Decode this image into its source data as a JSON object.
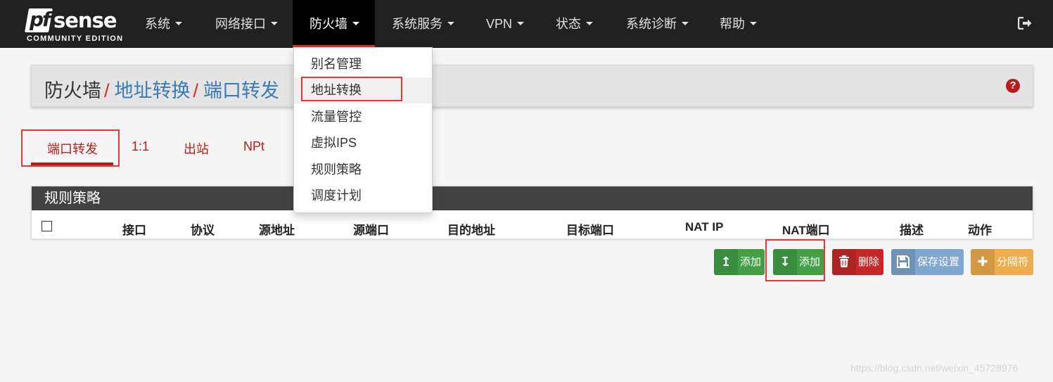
{
  "brand": {
    "logo_pf": "pf",
    "logo_sense": "sense",
    "edition": "COMMUNITY EDITION"
  },
  "nav": {
    "items": [
      {
        "label": "系统"
      },
      {
        "label": "网络接口"
      },
      {
        "label": "防火墙"
      },
      {
        "label": "系统服务"
      },
      {
        "label": "VPN"
      },
      {
        "label": "状态"
      },
      {
        "label": "系统诊断"
      },
      {
        "label": "帮助"
      }
    ],
    "active": "防火墙",
    "logout_icon": "sign-out-icon"
  },
  "breadcrumb": {
    "items": [
      "防火墙",
      "地址转换",
      "端口转发"
    ],
    "separator": "/",
    "help_icon": "question-circle-icon",
    "help_glyph": "?"
  },
  "dropdown": {
    "items": [
      "别名管理",
      "地址转换",
      "流量管控",
      "虚拟IPS",
      "规则策略",
      "调度计划"
    ],
    "highlighted": "地址转换"
  },
  "tabs": {
    "items": [
      "端口转发",
      "1:1",
      "出站",
      "NPt"
    ],
    "active": "端口转发"
  },
  "table": {
    "heading": "规则策略",
    "columns": [
      "接口",
      "协议",
      "源地址",
      "源端口",
      "目的地址",
      "目标端口",
      "NAT IP",
      "NAT端口",
      "描述",
      "动作"
    ]
  },
  "buttons": [
    {
      "label": "添加",
      "icon": "arrow-up-icon",
      "glyph": "↥",
      "color": "#43a047"
    },
    {
      "label": "添加",
      "icon": "arrow-down-icon",
      "glyph": "↧",
      "color": "#43a047"
    },
    {
      "label": "删除",
      "icon": "trash-icon",
      "glyph": "🗑",
      "color": "#c62828"
    },
    {
      "label": "保存设置",
      "icon": "save-icon",
      "glyph": "💾",
      "color": "#7fa7cf"
    },
    {
      "label": "分隔符",
      "icon": "plus-icon",
      "glyph": "✚",
      "color": "#f0ad4e"
    }
  ],
  "watermark": "https://blog.csdn.net/weixin_45728976"
}
